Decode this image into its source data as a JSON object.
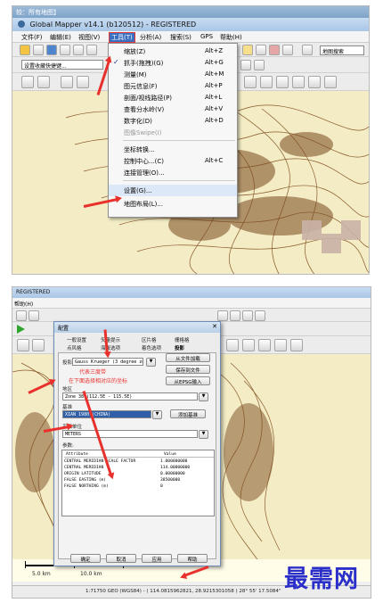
{
  "shot1": {
    "breadcrumb": "较：所有地图】",
    "title": "Global Mapper v14.1 (b120512) - REGISTERED",
    "menu": [
      "文件(F)",
      "编辑(E)",
      "视图(V)",
      "工具(T)",
      "分析(A)",
      "搜索(S)",
      "GPS",
      "帮助(H)"
    ],
    "active_menu": "工具(T)",
    "toolbar_combo": "设置收藏快捷键...",
    "search_box": "地图搜索",
    "tools_menu": [
      {
        "label": "缩放(Z)",
        "shortcut": "Alt+Z"
      },
      {
        "label": "抓手(拖拽)(G)",
        "shortcut": "Alt+G",
        "checked": true
      },
      {
        "label": "测量(M)",
        "shortcut": "Alt+M"
      },
      {
        "label": "图元信息(F)",
        "shortcut": "Alt+P"
      },
      {
        "label": "剖面/视线路径(P)",
        "shortcut": "Alt+L"
      },
      {
        "label": "查看分水岭(V)",
        "shortcut": "Alt+V"
      },
      {
        "label": "数字化(D)",
        "shortcut": "Alt+D"
      },
      {
        "label": "图像Swipe(I)",
        "shortcut": "",
        "disabled": true
      },
      {
        "label": "坐标转换...",
        "shortcut": ""
      },
      {
        "label": "控制中心...(C)",
        "shortcut": "Alt+C"
      },
      {
        "label": "连接管理(O)...",
        "shortcut": ""
      },
      {
        "label": "设置(G)...",
        "shortcut": "",
        "highlight": true
      },
      {
        "label": "地图布局(L)...",
        "shortcut": ""
      }
    ]
  },
  "shot2": {
    "title_fragment": "REGISTERED",
    "menu_fragment": "帮助(H)",
    "dialog_title": "配置",
    "tabs_row1": [
      "一般设置",
      "矢量提示",
      "区片格",
      "栅格格"
    ],
    "tabs_row2": [
      "点风格",
      "海拔选项",
      "着色选项",
      "投影"
    ],
    "projection_label": "投影",
    "projection_value": "Gauss Krueger (3 degree zones)",
    "annotation_1": "代表三度带",
    "annotation_2": "在下面选择相对应的坐标",
    "zone_label": "地区",
    "zone_value": "Zone 38 (112.5E - 115.5E)",
    "datum_label": "基准",
    "datum_value": "XIAN 1980 (CHINA)",
    "planar_units_label": "平面单位",
    "planar_units_value": "METERS",
    "params_label": "参数:",
    "buttons_right": [
      "从文件加载",
      "保存到文件",
      "从EPSG输入"
    ],
    "add_datum_btn": "添加基准",
    "table_header": [
      "Attribute",
      "Value"
    ],
    "table_rows": [
      [
        "CENTRAL MERIDIAN SCALE FACTOR",
        "1.000000000"
      ],
      [
        "CENTRAL MERIDIAN",
        "114.00000000"
      ],
      [
        "ORIGIN LATITUDE",
        "0.00000000"
      ],
      [
        "FALSE EASTING (m)",
        "38500000"
      ],
      [
        "FALSE NORTHING (m)",
        "0"
      ]
    ],
    "dialog_buttons": [
      "确定",
      "取消",
      "应用",
      "帮助"
    ],
    "scale_left": "5.0 km",
    "scale_right": "10.0 km",
    "status_text": "1:71750  GEO (WGS84) - ( 114.0815962821, 28.9215301058 )  28° 55' 17.5084\""
  },
  "watermark": "最需网",
  "colors": {
    "map_bg": "#f3ecc5",
    "contour": "#8a5a2b",
    "annotation_red": "#e8302c",
    "watermark_blue": "#2b2fc9"
  }
}
